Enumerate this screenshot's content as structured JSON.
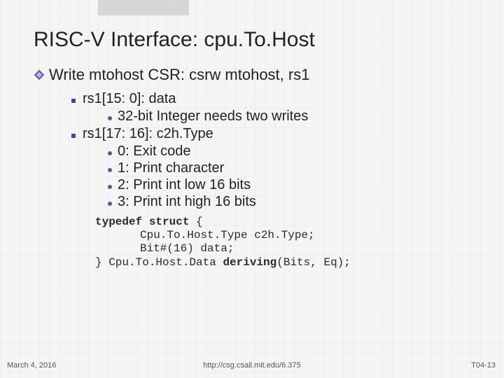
{
  "title": "RISC-V Interface: cpu.To.Host",
  "lvl0": "Write mtohost CSR: csrw mtohost, rs1",
  "bullets": {
    "b0": {
      "label": "rs1[15: 0]: data"
    },
    "b0s": {
      "s0": "32-bit Integer needs two writes"
    },
    "b1": {
      "label": "rs1[17: 16]: c2h.Type"
    },
    "b1s": {
      "s0": "0: Exit code",
      "s1": "1: Print character",
      "s2": "2: Print int low 16 bits",
      "s3": "3: Print int high 16 bits"
    }
  },
  "code": {
    "l0a": "typedef struct",
    "l0b": " {",
    "l1": "Cpu.To.Host.Type c2h.Type;",
    "l2": "Bit#(16) data;",
    "l3a": "} Cpu.To.Host.Data ",
    "l3b": "deriving",
    "l3c": "(Bits, Eq);"
  },
  "footer": {
    "left": "March 4, 2016",
    "center": "http://csg.csail.mit.edu/6.375",
    "right": "T04-13"
  }
}
